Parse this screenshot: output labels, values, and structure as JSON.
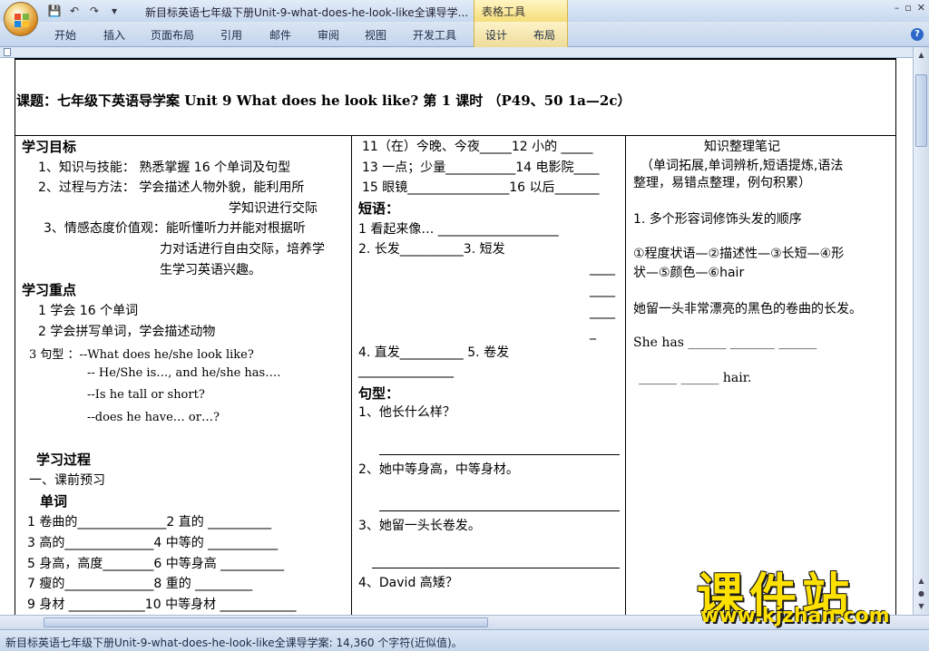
{
  "window": {
    "title": "新目标英语七年级下册Unit-9-what-does-he-look-like全课导学...",
    "context_tool": "表格工具",
    "controls": [
      "–",
      "▫",
      "✕"
    ]
  },
  "ribbon": {
    "tabs": [
      "开始",
      "插入",
      "页面布局",
      "引用",
      "邮件",
      "审阅",
      "视图",
      "开发工具",
      "设计",
      "布局"
    ]
  },
  "status": {
    "text": "新目标英语七年级下册Unit-9-what-does-he-look-like全课导学案: 14,360 个字符(近似值)。"
  },
  "doc": {
    "header": "课题：七年级下英语导学案   Unit 9 What does he look like?    第 1 课时  （P49、50   1a—2c）",
    "col1": {
      "goals_title": "学习目标",
      "g1": "1、知识与技能：     熟悉掌握 16 个单词及句型",
      "g2": "2、过程与方法：    学会描述人物外貌，能利用所",
      "g2b": "学知识进行交际",
      "g3": "3、情感态度价值观：能听懂听力并能对根据听",
      "g3b": "力对话进行自由交际，培养学",
      "g3c": "生学习英语兴趣。",
      "key_title": "学习重点",
      "k1": "1 学会 16 个单词",
      "k2": "2 学会拼写单词，学会描述动物",
      "k3": "3 句型  ：--What does he/she look like?",
      "k3b": "-- He/She is…, and he/she has….",
      "k3c": "--Is he tall or short?",
      "k3d": "--does he have… or…?",
      "process_title": "学习过程",
      "preview": "一、课前预习",
      "words": "单词",
      "w1": "1    卷曲的______________2 直的     __________",
      "w2": "3    高的______________4  中等的        ___________",
      "w3": "5    身高，高度________6 中等身高      __________",
      "w4": "7    瘦的______________8 重的         _________",
      "w5": "9 身材  ____________10  中等身材  ____________"
    },
    "col2": {
      "v1": "11（在）今晚、今夜_____12 小的  _____",
      "v2": "13 一点；少量___________14 电影院____",
      "v3": "15 眼镜________________16 以后_______",
      "phrases_title": "短语：",
      "p1": "1   看起来像…  ___________________",
      "p2": "2. 长发__________3.  短发",
      "p2a": "____",
      "p2b": "____",
      "p2c": "____",
      "p2d": "_",
      "p4": "4. 直发__________   5.   卷发",
      "p4b": "_______________",
      "sentence_title": "句型：",
      "s1": "1、他长什么样？",
      "s2": "2、她中等身高，中等身材。",
      "s3": "3、她留一头长卷发。",
      "s4": "4、David 高矮？"
    },
    "col3": {
      "title": "知识整理笔记",
      "intro": "（单词拓展,单词辨析,短语提炼,语法",
      "intro2": "整理，易错点整理，例句积累）",
      "n1": "1.  多个形容词修饰头发的顺序",
      "n2": "①程度状语—②描述性—③长短—④形",
      "n2b": "状—⑤颜色—⑥hair",
      "n3": "她留一头非常漂亮的黑色的卷曲的长发。",
      "n4": "She has  ______  _______   ______",
      "n5": "______  ______    hair."
    }
  },
  "watermark": {
    "main": "课件站",
    "url": "www.kjzhan.com"
  }
}
